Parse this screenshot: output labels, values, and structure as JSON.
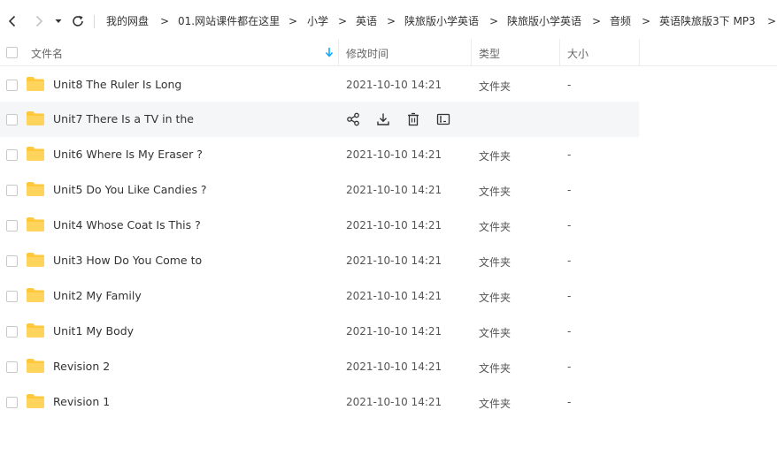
{
  "breadcrumb": [
    "我的网盘",
    "01.网站课件都在这里",
    "小学",
    "英语",
    "陕旅版小学英语",
    "陕旅版小学英语",
    "音频",
    "英语陕旅版3下  MP3"
  ],
  "breadcrumb_separator": ">",
  "header": {
    "name": "文件名",
    "mtime": "修改时间",
    "type": "类型",
    "size": "大小"
  },
  "icons": {
    "back": "chevron-left-icon",
    "forward": "chevron-right-icon",
    "history": "caret-down-icon",
    "refresh": "refresh-icon",
    "folder": "folder-icon",
    "share": "share-icon",
    "download": "download-icon",
    "delete": "trash-icon",
    "rename": "rename-icon"
  },
  "colors": {
    "folder": "#ffc83d",
    "accent": "#06a7ff",
    "hover_row": "#f5f6f8"
  },
  "files": [
    {
      "name": "Unit8 The Ruler Is Long",
      "mtime": "2021-10-10 14:21",
      "type": "文件夹",
      "size": "-"
    },
    {
      "name": "Unit7 There Is a TV in the",
      "mtime": "",
      "type": "",
      "size": "",
      "hovered": true
    },
    {
      "name": "Unit6 Where Is My Eraser ?",
      "mtime": "2021-10-10 14:21",
      "type": "文件夹",
      "size": "-"
    },
    {
      "name": "Unit5 Do You Like Candies ?",
      "mtime": "2021-10-10 14:21",
      "type": "文件夹",
      "size": "-"
    },
    {
      "name": "Unit4 Whose Coat Is This ?",
      "mtime": "2021-10-10 14:21",
      "type": "文件夹",
      "size": "-"
    },
    {
      "name": "Unit3 How Do You Come to",
      "mtime": "2021-10-10 14:21",
      "type": "文件夹",
      "size": "-"
    },
    {
      "name": "Unit2 My Family",
      "mtime": "2021-10-10 14:21",
      "type": "文件夹",
      "size": "-"
    },
    {
      "name": "Unit1 My Body",
      "mtime": "2021-10-10 14:21",
      "type": "文件夹",
      "size": "-"
    },
    {
      "name": "Revision 2",
      "mtime": "2021-10-10 14:21",
      "type": "文件夹",
      "size": "-"
    },
    {
      "name": "Revision 1",
      "mtime": "2021-10-10 14:21",
      "type": "文件夹",
      "size": "-"
    }
  ]
}
